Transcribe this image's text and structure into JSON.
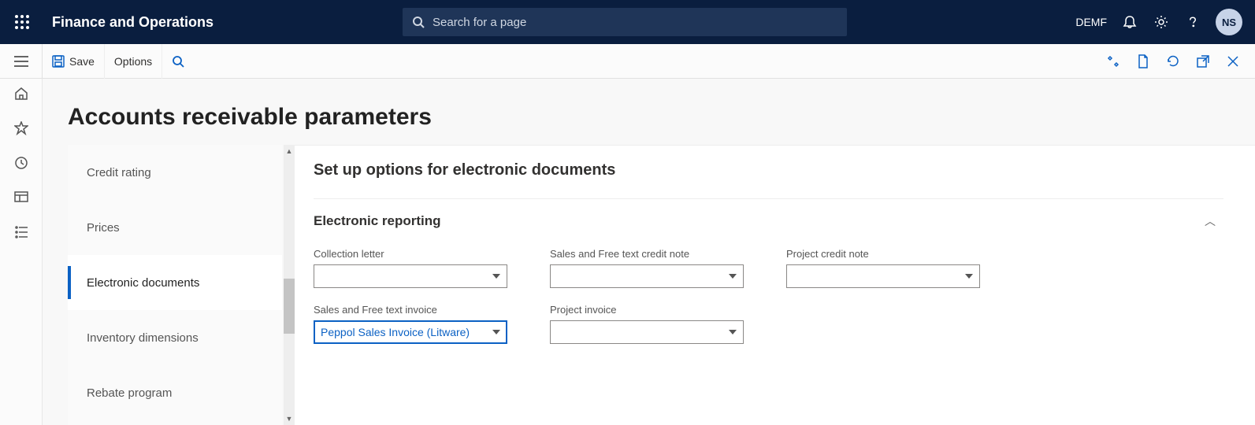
{
  "header": {
    "app_title": "Finance and Operations",
    "search_placeholder": "Search for a page",
    "company": "DEMF",
    "avatar_initials": "NS"
  },
  "actionbar": {
    "save_label": "Save",
    "options_label": "Options"
  },
  "page": {
    "title": "Accounts receivable parameters"
  },
  "sidebar": {
    "items": [
      {
        "label": "Credit rating"
      },
      {
        "label": "Prices"
      },
      {
        "label": "Electronic documents"
      },
      {
        "label": "Inventory dimensions"
      },
      {
        "label": "Rebate program"
      }
    ]
  },
  "form": {
    "title": "Set up options for electronic documents",
    "section_title": "Electronic reporting",
    "fields": {
      "collection_letter": {
        "label": "Collection letter",
        "value": ""
      },
      "sales_credit_note": {
        "label": "Sales and Free text credit note",
        "value": ""
      },
      "project_credit_note": {
        "label": "Project credit note",
        "value": ""
      },
      "sales_invoice": {
        "label": "Sales and Free text invoice",
        "value": "Peppol Sales Invoice (Litware)"
      },
      "project_invoice": {
        "label": "Project invoice",
        "value": ""
      }
    }
  }
}
